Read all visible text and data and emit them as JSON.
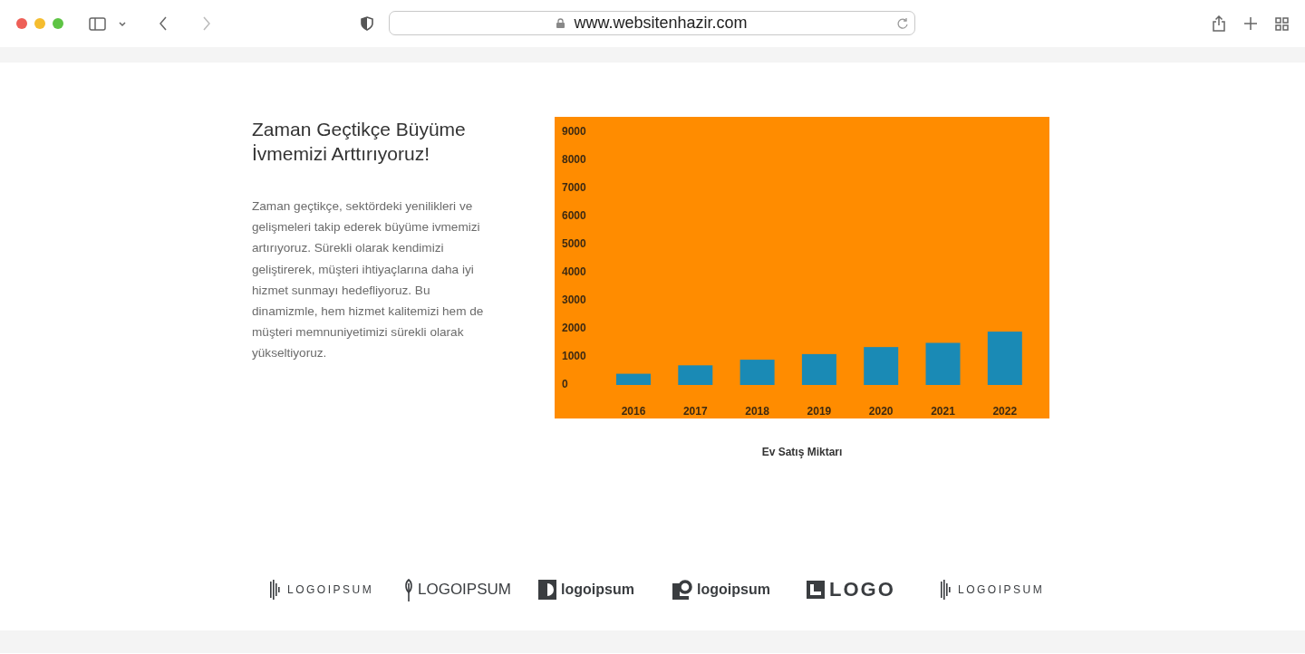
{
  "browser": {
    "url": "www.websitenhazir.com"
  },
  "section": {
    "heading": "Zaman Geçtikçe Büyüme İvmemizi Arttırıyoruz!",
    "body": "Zaman geçtikçe, sektördeki yenilikleri ve gelişmeleri takip ederek büyüme ivmemizi artırıyoruz. Sürekli olarak kendimizi geliştirerek, müşteri ihtiyaçlarına daha iyi hizmet sunmayı hedefliyoruz. Bu dinamizmle, hem hizmet kalitemizi hem de müşteri memnuniyetimizi sürekli olarak yükseltiyoruz."
  },
  "chart_data": {
    "type": "bar",
    "title": "Ev Satış Miktarı",
    "categories": [
      "2016",
      "2017",
      "2018",
      "2019",
      "2020",
      "2021",
      "2022"
    ],
    "series": [
      {
        "color": "#1a8ab5",
        "values": [
          400,
          700,
          900,
          1100,
          1350,
          1500,
          1900
        ]
      }
    ],
    "ylim": [
      0,
      9000
    ],
    "yticks": [
      0,
      1000,
      2000,
      3000,
      4000,
      5000,
      6000,
      7000,
      8000,
      9000
    ]
  },
  "logos": [
    {
      "kind": "bars",
      "text": "LOGOIPSUM"
    },
    {
      "kind": "wheat",
      "text": "LOGOIPSUM"
    },
    {
      "kind": "half-circle",
      "text": "logoipsum"
    },
    {
      "kind": "square-o",
      "text": "logoipsum"
    },
    {
      "kind": "block",
      "text": "LOGO"
    },
    {
      "kind": "bars",
      "text": "LOGOIPSUM"
    }
  ]
}
